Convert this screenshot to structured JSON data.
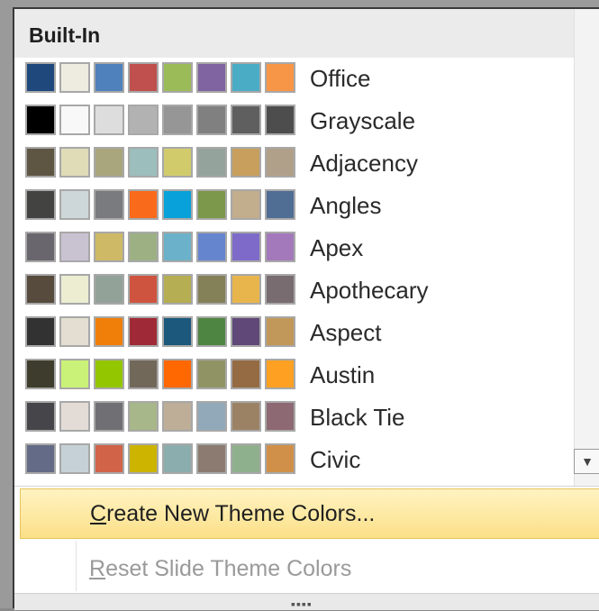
{
  "menu": {
    "header": "Built-In",
    "themes": [
      {
        "name": "Office",
        "colors": [
          "#1f497d",
          "#eeece1",
          "#4f81bd",
          "#c0504d",
          "#9bbb59",
          "#8064a2",
          "#4bacc6",
          "#f79646"
        ]
      },
      {
        "name": "Grayscale",
        "colors": [
          "#000000",
          "#f8f8f8",
          "#dddddd",
          "#b2b2b2",
          "#969696",
          "#808080",
          "#5f5f5f",
          "#4d4d4d"
        ]
      },
      {
        "name": "Adjacency",
        "colors": [
          "#5e5543",
          "#dfdcb7",
          "#a9a57c",
          "#9cbebd",
          "#d2cb6c",
          "#95a39d",
          "#c89f5d",
          "#b1a089"
        ]
      },
      {
        "name": "Angles",
        "colors": [
          "#434342",
          "#cdd7d9",
          "#797b7e",
          "#f96a1b",
          "#08a1d9",
          "#7c984a",
          "#c2ad8d",
          "#506e94"
        ]
      },
      {
        "name": "Apex",
        "colors": [
          "#69676d",
          "#c9c2d1",
          "#ceb966",
          "#9cb084",
          "#6bb1c9",
          "#6585cf",
          "#7e6bc9",
          "#a379bb"
        ]
      },
      {
        "name": "Apothecary",
        "colors": [
          "#564b3c",
          "#ecedd1",
          "#93a299",
          "#cf543f",
          "#b5ae53",
          "#848058",
          "#e8b54d",
          "#786c71"
        ]
      },
      {
        "name": "Aspect",
        "colors": [
          "#323232",
          "#e3ded1",
          "#f07f09",
          "#9f2936",
          "#1b587c",
          "#4e8542",
          "#604878",
          "#c19859"
        ]
      },
      {
        "name": "Austin",
        "colors": [
          "#3e3d2d",
          "#caf278",
          "#94c600",
          "#71685a",
          "#ff6700",
          "#909465",
          "#956b43",
          "#fea022"
        ]
      },
      {
        "name": "Black Tie",
        "colors": [
          "#46464a",
          "#e3dcd6",
          "#6f6f74",
          "#a7b789",
          "#beae98",
          "#92a9b9",
          "#9c8265",
          "#8d6974"
        ]
      },
      {
        "name": "Civic",
        "colors": [
          "#646b86",
          "#c5d1d7",
          "#d16349",
          "#ccb400",
          "#8cadae",
          "#8c7b70",
          "#8fb08c",
          "#d19049"
        ]
      }
    ],
    "scroll_down_glyph": "▼",
    "create_label_accel": "C",
    "create_label_rest": "reate New Theme Colors...",
    "reset_label_accel": "R",
    "reset_label_rest": "eset Slide Theme Colors",
    "grip_glyph": "▪▪▪▪",
    "accent_arrow_color": "#f38b2d"
  }
}
